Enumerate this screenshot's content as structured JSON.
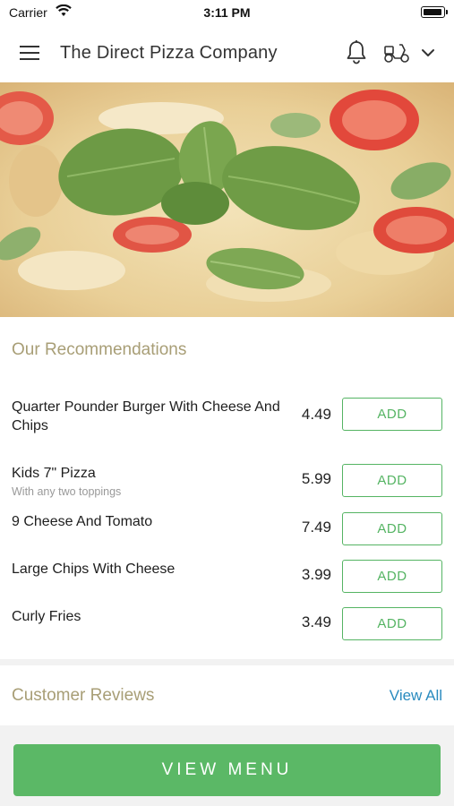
{
  "status_bar": {
    "carrier": "Carrier",
    "time": "3:11 PM"
  },
  "header": {
    "title": "The Direct Pizza Company",
    "icons": [
      "menu-icon",
      "bell-icon",
      "scooter-icon",
      "chevron-down-icon"
    ]
  },
  "hero": {
    "image": "pizza with basil leaves and tomatoes"
  },
  "recommendations": {
    "title": "Our Recommendations",
    "add_label": "ADD",
    "items": [
      {
        "name": "Quarter Pounder Burger With Cheese And Chips",
        "description": "",
        "price": "4.49"
      },
      {
        "name": "Kids 7\" Pizza",
        "description": "With any two toppings",
        "price": "5.99"
      },
      {
        "name": "9 Cheese And Tomato",
        "description": "",
        "price": "7.49"
      },
      {
        "name": "Large Chips With Cheese",
        "description": "",
        "price": "3.99"
      },
      {
        "name": "Curly Fries",
        "description": "",
        "price": "3.49"
      }
    ]
  },
  "reviews": {
    "title": "Customer Reviews",
    "view_all": "View All"
  },
  "footer": {
    "view_menu": "VIEW MENU"
  },
  "colors": {
    "accent_green": "#5bb866",
    "section_title": "#a89e76",
    "link_blue": "#2a8bbf"
  }
}
